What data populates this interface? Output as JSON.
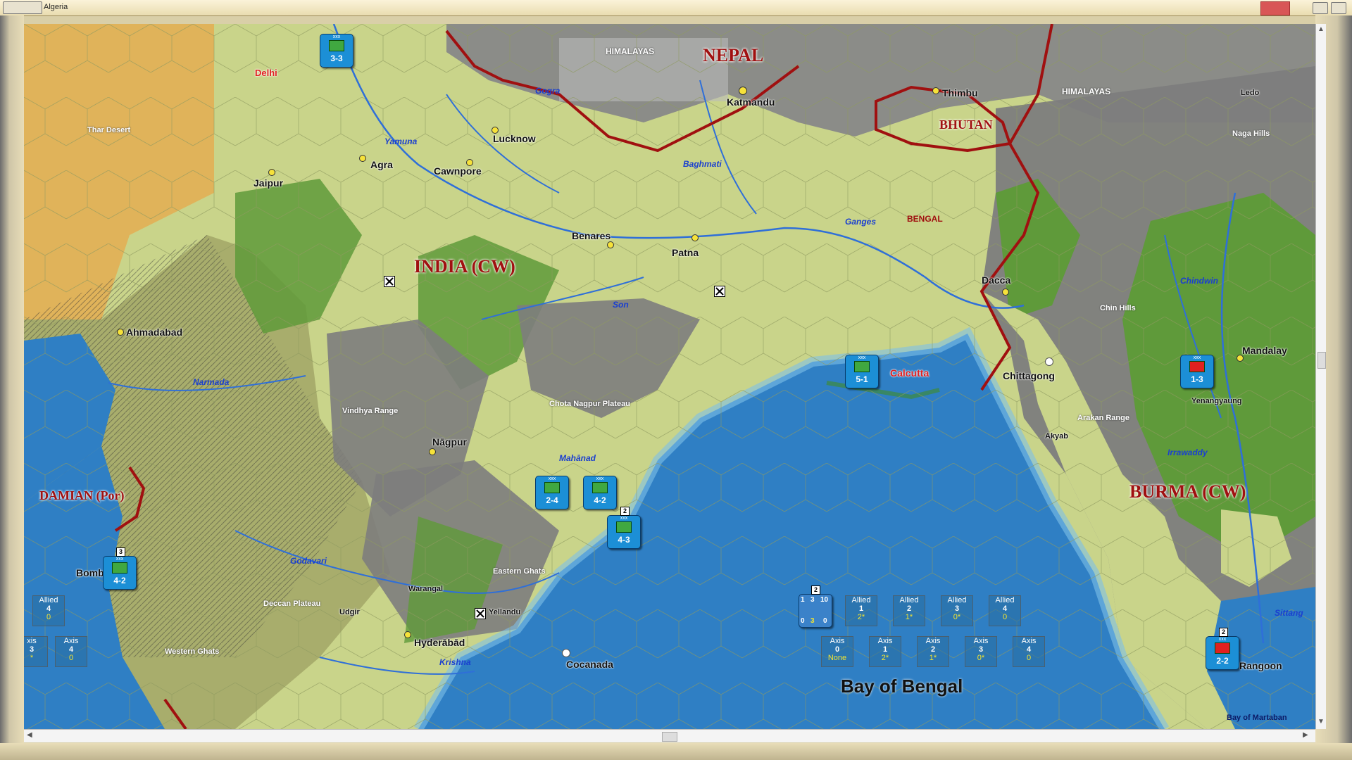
{
  "window": {
    "title": "Algeria"
  },
  "map": {
    "countries": [
      {
        "key": "india",
        "label": "INDIA (CW)"
      },
      {
        "key": "nepal",
        "label": "NEPAL"
      },
      {
        "key": "bhutan",
        "label": "BHUTAN"
      },
      {
        "key": "burma",
        "label": "BURMA (CW)"
      },
      {
        "key": "damian",
        "label": "DAMIAN (Por)"
      }
    ],
    "cities": [
      "Delhi",
      "Jaipur",
      "Agra",
      "Lucknow",
      "Cawnpore",
      "Katmandu",
      "Thimbu",
      "Benares",
      "Patna",
      "Dacca",
      "Calcutta",
      "Chittagong",
      "Ahmadabad",
      "Nāgpur",
      "Hyderābād",
      "Cocanada",
      "Bombay",
      "Mandalay",
      "Ledo",
      "Rangoon",
      "Yellandu",
      "Warangal",
      "Udgir",
      "Akyab",
      "Yenangyaung"
    ],
    "regions": [
      "HIMALAYAS",
      "HIMALAYAS",
      "Thar Desert",
      "Naga Hills",
      "Chin Hills",
      "Vindhya Range",
      "Chota Nagpur Plateau",
      "Eastern Ghats",
      "Deccan Plateau",
      "Western Ghats",
      "Arakan Range",
      "BENGAL"
    ],
    "rivers": [
      "Gogra",
      "Yamuna",
      "Baghmati",
      "Ganges",
      "Son",
      "Narmada",
      "Mahānad",
      "Godavari",
      "Krishna",
      "Chindwin",
      "Irrawaddy",
      "Sittang"
    ],
    "seas": {
      "bay_of_bengal": "Bay of Bengal",
      "bay_of_martaban": "Bay of Martaban"
    }
  },
  "units": [
    {
      "id": "u1",
      "strength": "3-3",
      "side": "allied",
      "stack": ""
    },
    {
      "id": "u2",
      "strength": "5-1",
      "side": "allied",
      "stack": ""
    },
    {
      "id": "u3",
      "strength": "2-4",
      "side": "allied",
      "stack": ""
    },
    {
      "id": "u4",
      "strength": "4-2",
      "side": "allied",
      "stack": ""
    },
    {
      "id": "u5",
      "strength": "4-3",
      "side": "allied",
      "stack": "2"
    },
    {
      "id": "u6",
      "strength": "4-2",
      "side": "allied",
      "stack": "3"
    },
    {
      "id": "u7",
      "strength": "1-3",
      "side": "axis",
      "stack": ""
    },
    {
      "id": "u8",
      "strength": "2-2",
      "side": "axis",
      "stack": "2"
    }
  ],
  "weather_boxes": {
    "left_allied": {
      "side": "Allied",
      "n": "4",
      "v": "0"
    },
    "left_axis_partial": {
      "side": "xis",
      "n": "3",
      "v": "*"
    },
    "left_axis": {
      "side": "Axis",
      "n": "4",
      "v": "0"
    },
    "allied": [
      {
        "side": "Allied",
        "n": "1",
        "v": "2*"
      },
      {
        "side": "Allied",
        "n": "2",
        "v": "1*"
      },
      {
        "side": "Allied",
        "n": "3",
        "v": "0*"
      },
      {
        "side": "Allied",
        "n": "4",
        "v": "0"
      }
    ],
    "axis": [
      {
        "side": "Axis",
        "n": "0",
        "v": "None"
      },
      {
        "side": "Axis",
        "n": "1",
        "v": "2*"
      },
      {
        "side": "Axis",
        "n": "2",
        "v": "1*"
      },
      {
        "side": "Axis",
        "n": "3",
        "v": "0*"
      },
      {
        "side": "Axis",
        "n": "4",
        "v": "0"
      }
    ]
  },
  "fleet_marker": {
    "a": "1",
    "b": "3",
    "c": "10",
    "d": "0",
    "e": "3",
    "f": "0",
    "stack": "2"
  },
  "colors": {
    "sea": "#2f7fc4",
    "clear": "#c9d48a",
    "forest": "#5f9a3a",
    "mountain": "#7d7d7d",
    "desert": "#e0b35a",
    "border": "#a01010"
  }
}
